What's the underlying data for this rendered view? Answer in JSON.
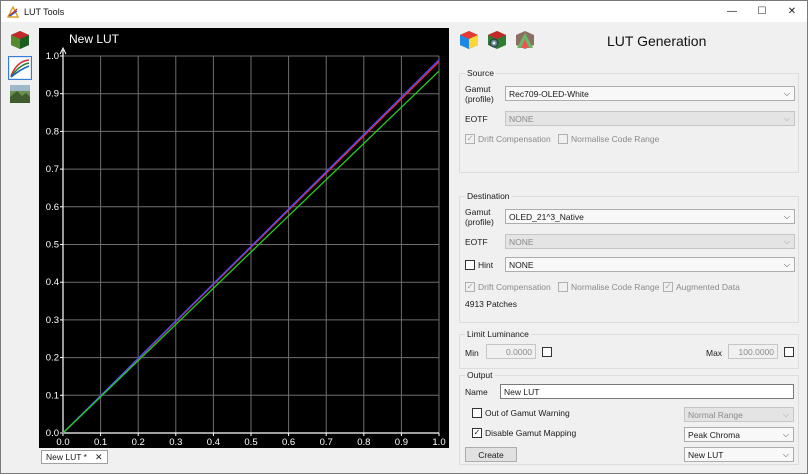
{
  "window": {
    "title": "LUT Tools",
    "controls": {
      "minimize": "—",
      "maximize": "☐",
      "close": "✕"
    }
  },
  "plot": {
    "title": "New LUT",
    "tab_label": "New LUT *",
    "tab_close": "✕",
    "colors": {
      "red": "#ff2a2a",
      "green": "#22d022",
      "blue": "#4a4aff",
      "grid": "#6e6e6e",
      "axis": "#ffffff"
    }
  },
  "chart_data": {
    "type": "line",
    "title": "New LUT",
    "xlabel": "",
    "ylabel": "",
    "xlim": [
      0.0,
      1.0
    ],
    "ylim": [
      0.0,
      1.0
    ],
    "grid": true,
    "x_ticks": [
      "0.0",
      "0.1",
      "0.2",
      "0.3",
      "0.4",
      "0.5",
      "0.6",
      "0.7",
      "0.8",
      "0.9",
      "1.0"
    ],
    "y_ticks": [
      "0.0",
      "0.1",
      "0.2",
      "0.3",
      "0.4",
      "0.5",
      "0.6",
      "0.7",
      "0.8",
      "0.9",
      "1.0"
    ],
    "x": [
      0.0,
      1.0
    ],
    "series": [
      {
        "color": "#ff2a2a",
        "values": [
          0.0,
          0.985
        ]
      },
      {
        "color": "#4a4aff",
        "values": [
          0.0,
          0.99
        ]
      },
      {
        "color": "#22d022",
        "values": [
          0.0,
          0.96
        ]
      }
    ]
  },
  "heading": "LUT Generation",
  "source": {
    "title": "Source",
    "gamut_label_1": "Gamut",
    "gamut_label_2": "(profile)",
    "gamut_value": "Rec709-OLED-White",
    "eotf_label": "EOTF",
    "eotf_value": "NONE",
    "drift_label": "Drift Compensation",
    "drift_checked": "✓",
    "normalise_label": "Normalise Code Range"
  },
  "destination": {
    "title": "Destination",
    "gamut_label_1": "Gamut",
    "gamut_label_2": "(profile)",
    "gamut_value": "OLED_21^3_Native",
    "eotf_label": "EOTF",
    "eotf_value": "NONE",
    "hint_label": "Hint",
    "hint_value": "NONE",
    "drift_label": "Drift Compensation",
    "drift_checked": "✓",
    "normalise_label": "Normalise Code Range",
    "augmented_label": "Augmented Data",
    "augmented_checked": "✓",
    "patches": "4913 Patches"
  },
  "limit": {
    "title": "Limit Luminance",
    "min_label": "Min",
    "min_value": "0.0000",
    "max_label": "Max",
    "max_value": "100.0000"
  },
  "output": {
    "title": "Output",
    "name_label": "Name",
    "name_value": "New LUT",
    "oog_label": "Out of Gamut Warning",
    "range_value": "Normal Range",
    "disable_label": "Disable Gamut Mapping",
    "disable_checked": "✓",
    "chroma_value": "Peak Chroma",
    "create_label": "Create",
    "lut_value": "New LUT"
  },
  "arrow": "⌵"
}
